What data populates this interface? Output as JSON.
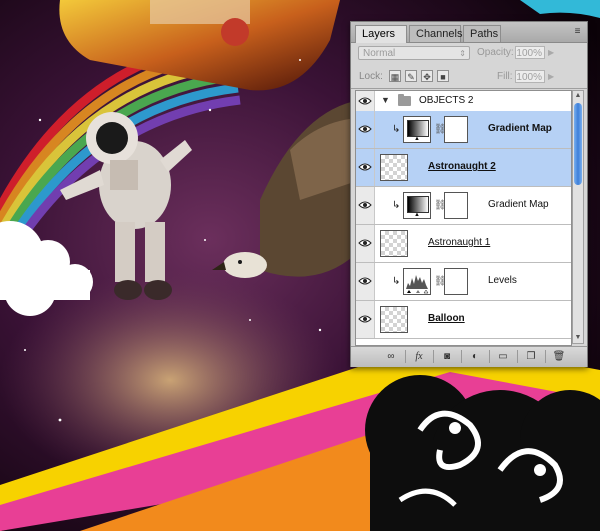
{
  "panel": {
    "tabs": [
      {
        "label": "Layers",
        "active": true
      },
      {
        "label": "Channels",
        "active": false
      },
      {
        "label": "Paths",
        "active": false
      }
    ],
    "close_glyph": "✕",
    "menu_glyph": "≡",
    "blend_mode": "Normal",
    "opacity_label": "Opacity:",
    "opacity_value": "100%",
    "lock_label": "Lock:",
    "fill_label": "Fill:",
    "fill_value": "100%",
    "group": {
      "name": "OBJECTS 2"
    },
    "layers": [
      {
        "name": "Gradient Map",
        "type": "adjustment",
        "selected": true,
        "clipped": true,
        "style": "bold"
      },
      {
        "name": "Astronaught 2",
        "type": "pixel",
        "selected": true,
        "clipped": false,
        "style": "bold-underline"
      },
      {
        "name": "Gradient Map",
        "type": "adjustment",
        "selected": false,
        "clipped": true,
        "style": "normal"
      },
      {
        "name": "Astronaught 1",
        "type": "pixel",
        "selected": false,
        "clipped": false,
        "style": "underline"
      },
      {
        "name": "Levels",
        "type": "adjustment",
        "selected": false,
        "clipped": true,
        "style": "normal"
      },
      {
        "name": "Balloon",
        "type": "pixel",
        "selected": false,
        "clipped": false,
        "style": "bold-underline"
      }
    ],
    "bottom_icons": {
      "link": "∞",
      "fx": "fx",
      "mask": "◙",
      "adjustment": "◐",
      "folder": "▭",
      "new": "❐",
      "trash": "🗑"
    }
  },
  "colors": {
    "selection": "#b6d1f5",
    "scroll_thumb": "#3d7fd9",
    "rainbow_yellow": "#f7d200",
    "rainbow_pink": "#e83f95",
    "rainbow_orange": "#f28a1c"
  }
}
